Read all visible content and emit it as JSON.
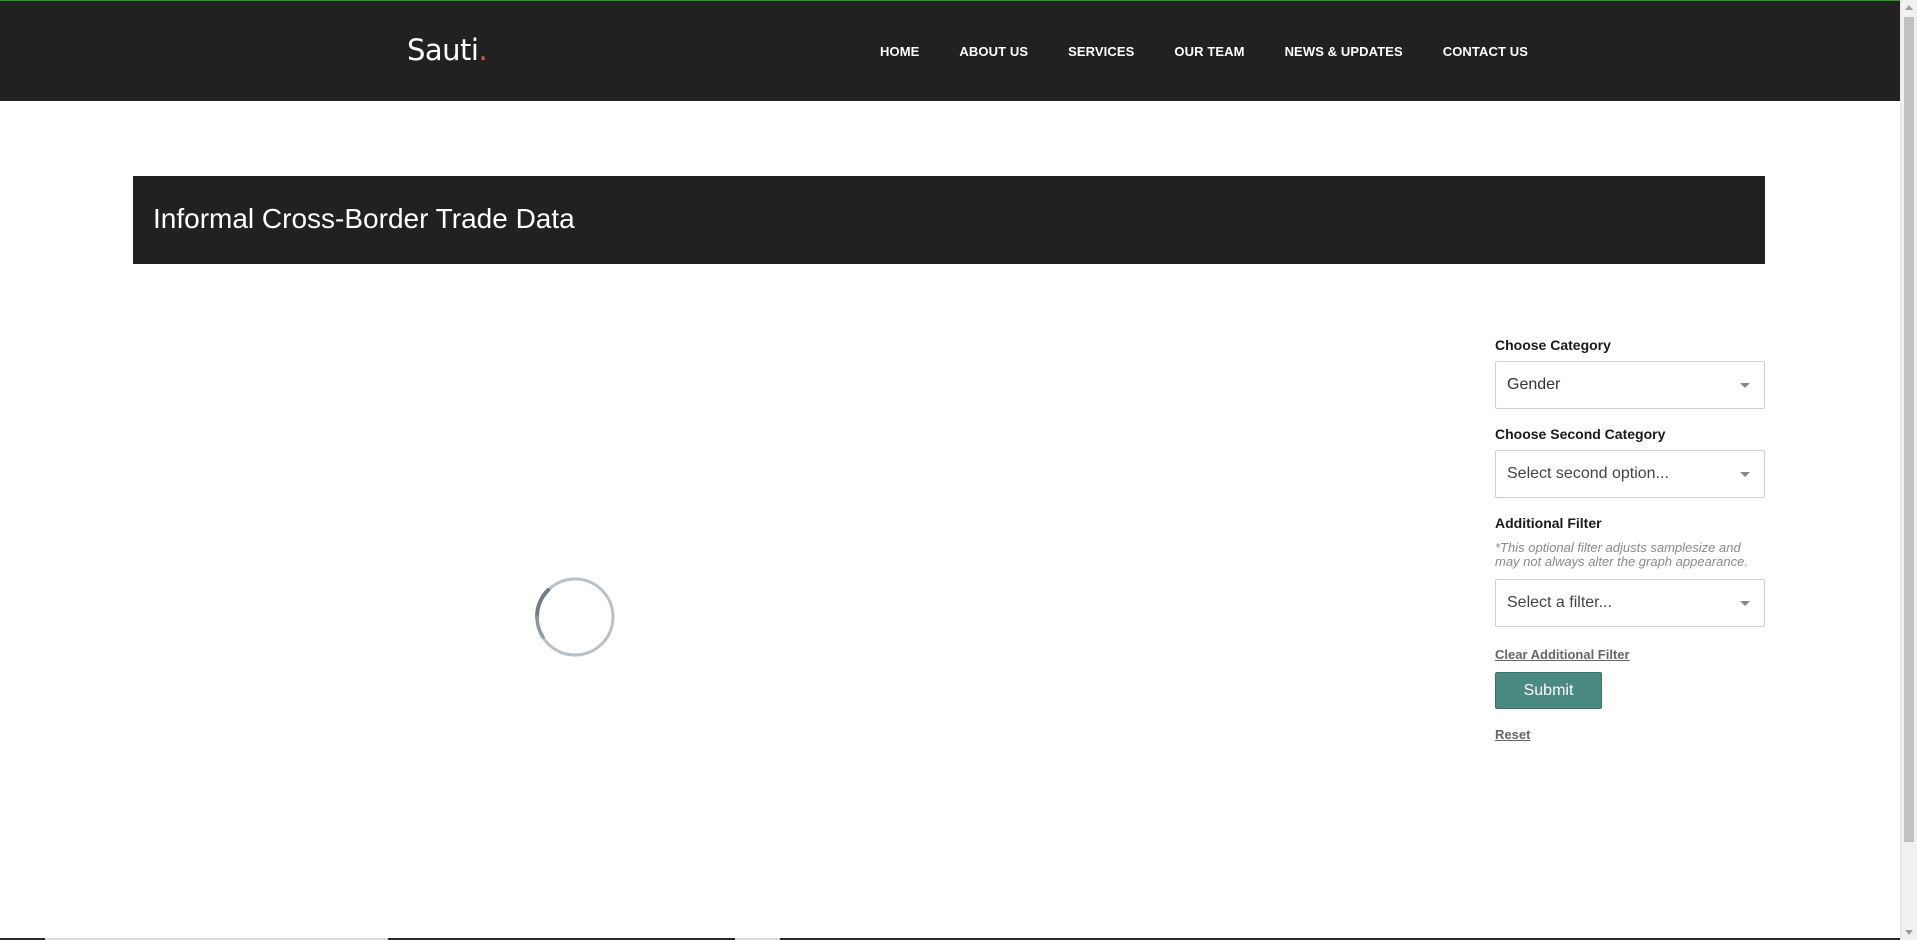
{
  "header": {
    "logo_text": "Sauti",
    "logo_dot": ".",
    "nav": [
      {
        "label": "HOME"
      },
      {
        "label": "ABOUT US"
      },
      {
        "label": "SERVICES"
      },
      {
        "label": "OUR TEAM"
      },
      {
        "label": "NEWS & UPDATES"
      },
      {
        "label": "CONTACT US"
      }
    ]
  },
  "banner": {
    "title": "Informal Cross-Border Trade Data"
  },
  "main": {
    "loading": true
  },
  "filters": {
    "category": {
      "label": "Choose Category",
      "value": "Gender"
    },
    "second_category": {
      "label": "Choose Second Category",
      "placeholder": "Select second option..."
    },
    "additional_filter": {
      "label": "Additional Filter",
      "note": "*This optional filter adjusts samplesize and may not always alter the graph appearance.",
      "placeholder": "Select a filter..."
    },
    "clear_label": "Clear Additional Filter",
    "submit_label": "Submit",
    "reset_label": "Reset"
  },
  "colors": {
    "header_bg": "#212121",
    "accent": "#4b8a80",
    "logo_dot": "#e0524a"
  }
}
